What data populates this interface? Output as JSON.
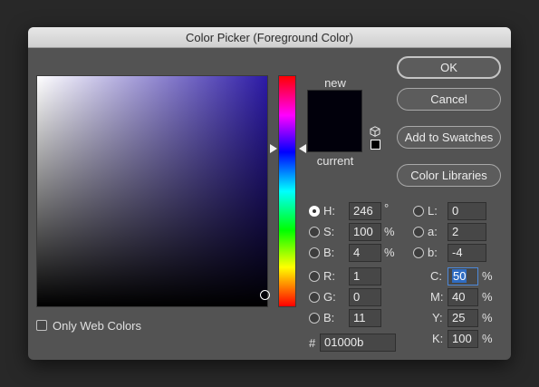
{
  "window": {
    "title": "Color Picker (Foreground Color)"
  },
  "buttons": {
    "ok": "OK",
    "cancel": "Cancel",
    "add_to_swatches": "Add to Swatches",
    "color_libraries": "Color Libraries"
  },
  "preview": {
    "new_label": "new",
    "current_label": "current",
    "new_color": "#01000b",
    "current_color": "#01000b"
  },
  "hsb": {
    "h": {
      "label": "H:",
      "value": "246",
      "unit": "°",
      "selected": true
    },
    "s": {
      "label": "S:",
      "value": "100",
      "unit": "%"
    },
    "b": {
      "label": "B:",
      "value": "4",
      "unit": "%"
    }
  },
  "rgb": {
    "r": {
      "label": "R:",
      "value": "1"
    },
    "g": {
      "label": "G:",
      "value": "0"
    },
    "b": {
      "label": "B:",
      "value": "11"
    }
  },
  "lab": {
    "l": {
      "label": "L:",
      "value": "0"
    },
    "a": {
      "label": "a:",
      "value": "2"
    },
    "b": {
      "label": "b:",
      "value": "-4"
    }
  },
  "cmyk": {
    "c": {
      "label": "C:",
      "value": "50",
      "unit": "%"
    },
    "m": {
      "label": "M:",
      "value": "40",
      "unit": "%"
    },
    "y": {
      "label": "Y:",
      "value": "25",
      "unit": "%"
    },
    "k": {
      "label": "K:",
      "value": "100",
      "unit": "%"
    }
  },
  "hex": {
    "label": "#",
    "value": "01000b"
  },
  "only_web_colors": {
    "label": "Only Web Colors",
    "checked": false
  },
  "icons": {
    "cube": "websafe-cube-icon",
    "warning_swatch": "websafe-swatch-icon"
  }
}
